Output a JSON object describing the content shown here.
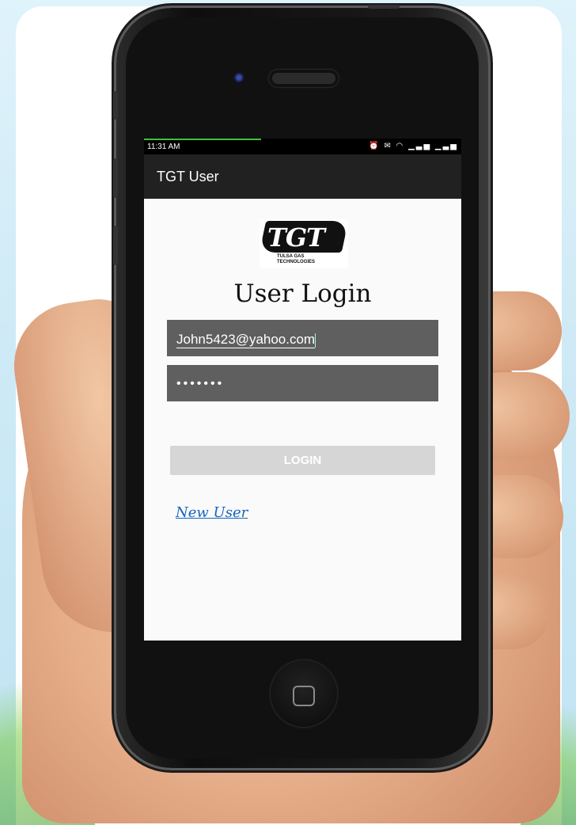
{
  "status_bar": {
    "time": "11:31 AM",
    "icons": [
      "alarm-icon",
      "mail-icon",
      "wifi-icon",
      "signal-icon",
      "signal-icon"
    ]
  },
  "app_bar": {
    "title": "TGT User"
  },
  "logo": {
    "text": "TGT",
    "subtext": "TULSA GAS TECHNOLOGIES"
  },
  "login": {
    "heading": "User Login",
    "email_value": "John5423@yahoo.com",
    "password_value": "•••••••",
    "login_button": "LOGIN",
    "new_user_link": "New User"
  },
  "colors": {
    "app_bar": "#212121",
    "input_bg": "#5f5f5f",
    "login_button": "#d6d6d6",
    "link": "#1565c0",
    "progress": "#3fbf3f"
  }
}
